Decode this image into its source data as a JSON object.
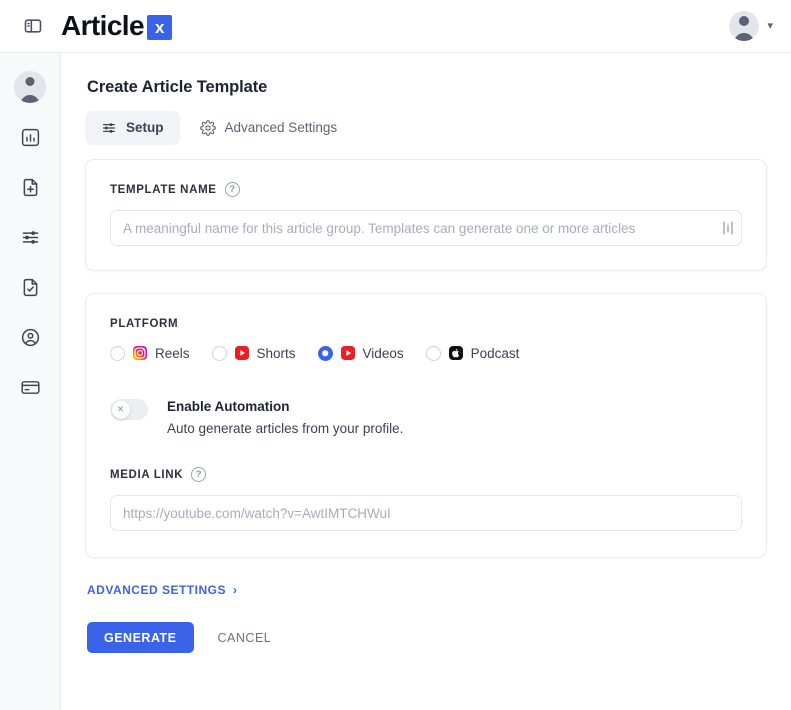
{
  "topbar": {
    "panel_toggle_icon": "panel-layout-icon",
    "brand_text": "Article",
    "brand_badge": "x",
    "avatar_icon": "user-avatar-icon",
    "chevron_icon": "▾"
  },
  "sidebar": {
    "items": [
      {
        "name": "profile",
        "icon": "user-avatar-icon"
      },
      {
        "name": "analytics",
        "icon": "bar-chart-icon"
      },
      {
        "name": "new-document",
        "icon": "document-plus-icon"
      },
      {
        "name": "settings-sliders",
        "icon": "sliders-icon"
      },
      {
        "name": "document-check",
        "icon": "document-check-icon"
      },
      {
        "name": "account",
        "icon": "user-circle-icon"
      },
      {
        "name": "billing",
        "icon": "credit-card-icon"
      }
    ]
  },
  "main": {
    "page_title": "Create Article Template",
    "tabs": [
      {
        "label": "Setup",
        "icon": "sliders-icon",
        "active": true
      },
      {
        "label": "Advanced Settings",
        "icon": "gear-icon",
        "active": false
      }
    ],
    "template_name": {
      "label": "TEMPLATE NAME",
      "help_icon": "?",
      "value": "",
      "placeholder": "A meaningful name for this article group. Templates can generate one or more articles",
      "resize_handle_icon": "resize-handle-icon"
    },
    "platform": {
      "label": "PLATFORM",
      "options": [
        {
          "label": "Reels",
          "icon": "instagram-icon",
          "selected": false
        },
        {
          "label": "Shorts",
          "icon": "youtube-icon",
          "selected": false
        },
        {
          "label": "Videos",
          "icon": "youtube-icon",
          "selected": true
        },
        {
          "label": "Podcast",
          "icon": "apple-podcasts-icon",
          "selected": false
        }
      ]
    },
    "automation": {
      "toggle_state": "off",
      "toggle_knob_glyph": "✕",
      "title": "Enable Automation",
      "subtitle": "Auto generate articles from your profile."
    },
    "media_link": {
      "label": "MEDIA LINK",
      "help_icon": "?",
      "value": "",
      "placeholder": "https://youtube.com/watch?v=AwtIMTCHWuI"
    },
    "advanced_settings_link": {
      "label": "ADVANCED SETTINGS",
      "arrow": "›"
    },
    "buttons": {
      "generate": "GENERATE",
      "cancel": "CANCEL"
    }
  },
  "colors": {
    "accent": "#3b63e8",
    "youtube_red": "#ed1d24",
    "podcast_black": "#111111",
    "rail_bg": "#f8f9fb",
    "text_primary": "#1d2330"
  }
}
